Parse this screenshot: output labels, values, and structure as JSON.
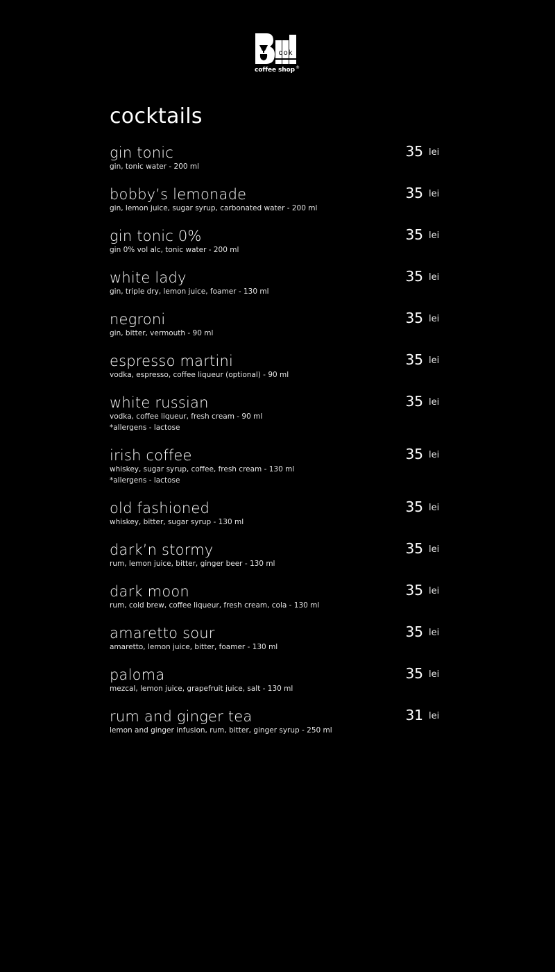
{
  "brand": {
    "logo_letter": "B",
    "logo_word": "ook",
    "name": "coffee shop",
    "registered": "®"
  },
  "title": "cocktails",
  "currency": "lei",
  "items": [
    {
      "name": "gin tonic",
      "desc": "gin, tonic water   -   200 ml",
      "note": "",
      "price": "35"
    },
    {
      "name": "bobby’s lemonade",
      "desc": "gin, lemon juice, sugar syrup, carbonated water   -   200 ml",
      "note": "",
      "price": "35"
    },
    {
      "name": "gin tonic 0%",
      "desc": "gin 0% vol alc, tonic water   -   200 ml",
      "note": "",
      "price": "35"
    },
    {
      "name": "white lady",
      "desc": "gin, triple dry, lemon juice, foamer   -   130 ml",
      "note": "",
      "price": "35"
    },
    {
      "name": "negroni",
      "desc": "gin, bitter, vermouth   -   90 ml",
      "note": "",
      "price": "35"
    },
    {
      "name": "espresso martini",
      "desc": "vodka, espresso, coffee liqueur (optional)   -   90 ml",
      "note": "",
      "price": "35"
    },
    {
      "name": "white russian",
      "desc": "vodka, coffee liqueur, fresh cream   -   90 ml",
      "note": "*allergens - lactose",
      "price": "35"
    },
    {
      "name": "irish coffee",
      "desc": "whiskey, sugar syrup, coffee, fresh cream   -   130 ml",
      "note": "*allergens - lactose",
      "price": "35"
    },
    {
      "name": "old fashioned",
      "desc": "whiskey, bitter, sugar syrup   -   130 ml",
      "note": "",
      "price": "35"
    },
    {
      "name": "dark’n stormy",
      "desc": "rum, lemon juice, bitter, ginger beer   -   130 ml",
      "note": "",
      "price": "35"
    },
    {
      "name": "dark moon",
      "desc": "rum, cold brew, coffee liqueur, fresh cream, cola   -   130 ml",
      "note": "",
      "price": "35"
    },
    {
      "name": "amaretto sour",
      "desc": "amaretto, lemon juice, bitter, foamer   -   130 ml",
      "note": "",
      "price": "35"
    },
    {
      "name": "paloma",
      "desc": "mezcal, lemon juice, grapefruit juice, salt   -   130 ml",
      "note": "",
      "price": "35"
    },
    {
      "name": "rum and ginger tea",
      "desc": "lemon and ginger infusion, rum, bitter, ginger syrup   -   250 ml",
      "note": "",
      "price": "31"
    }
  ]
}
